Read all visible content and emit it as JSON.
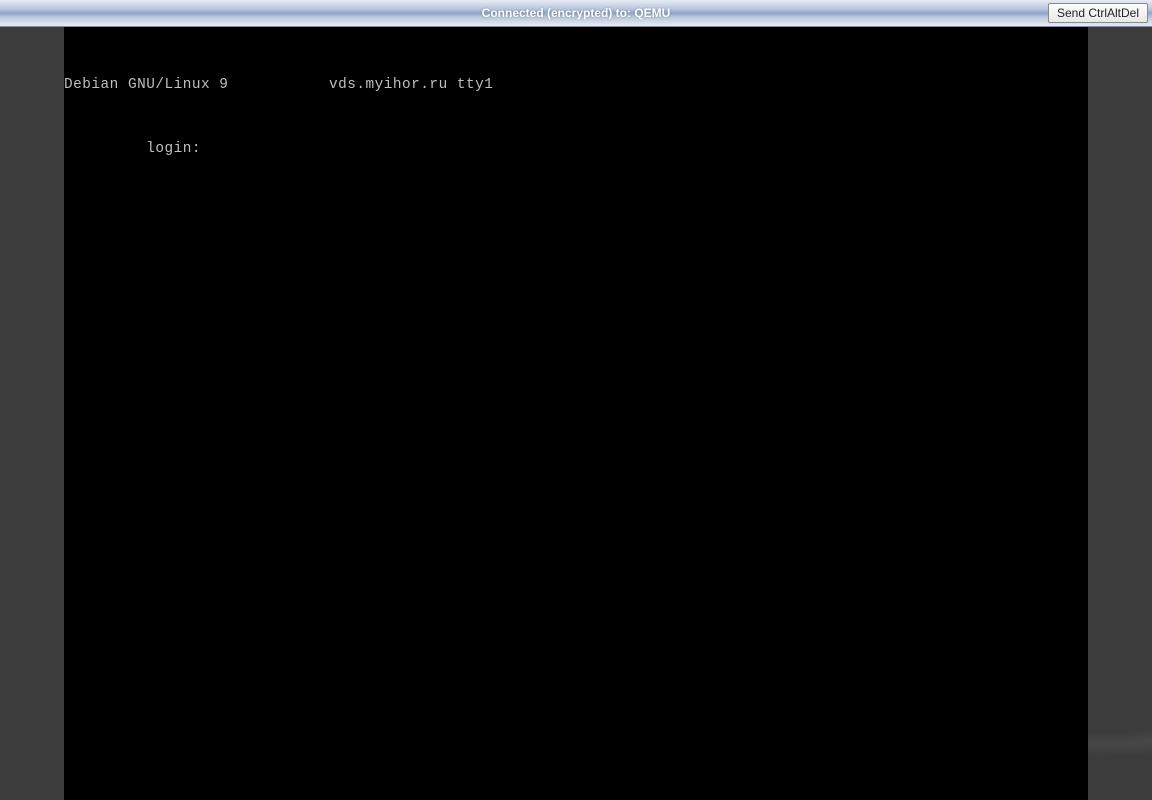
{
  "status_bar": {
    "connection_text": "Connected (encrypted) to: QEMU",
    "ctrl_alt_del_label": "Send CtrlAltDel"
  },
  "console": {
    "banner_line": "Debian GNU/Linux 9           vds.myihor.ru tty1",
    "login_prompt": "         login: ",
    "login_value": ""
  }
}
